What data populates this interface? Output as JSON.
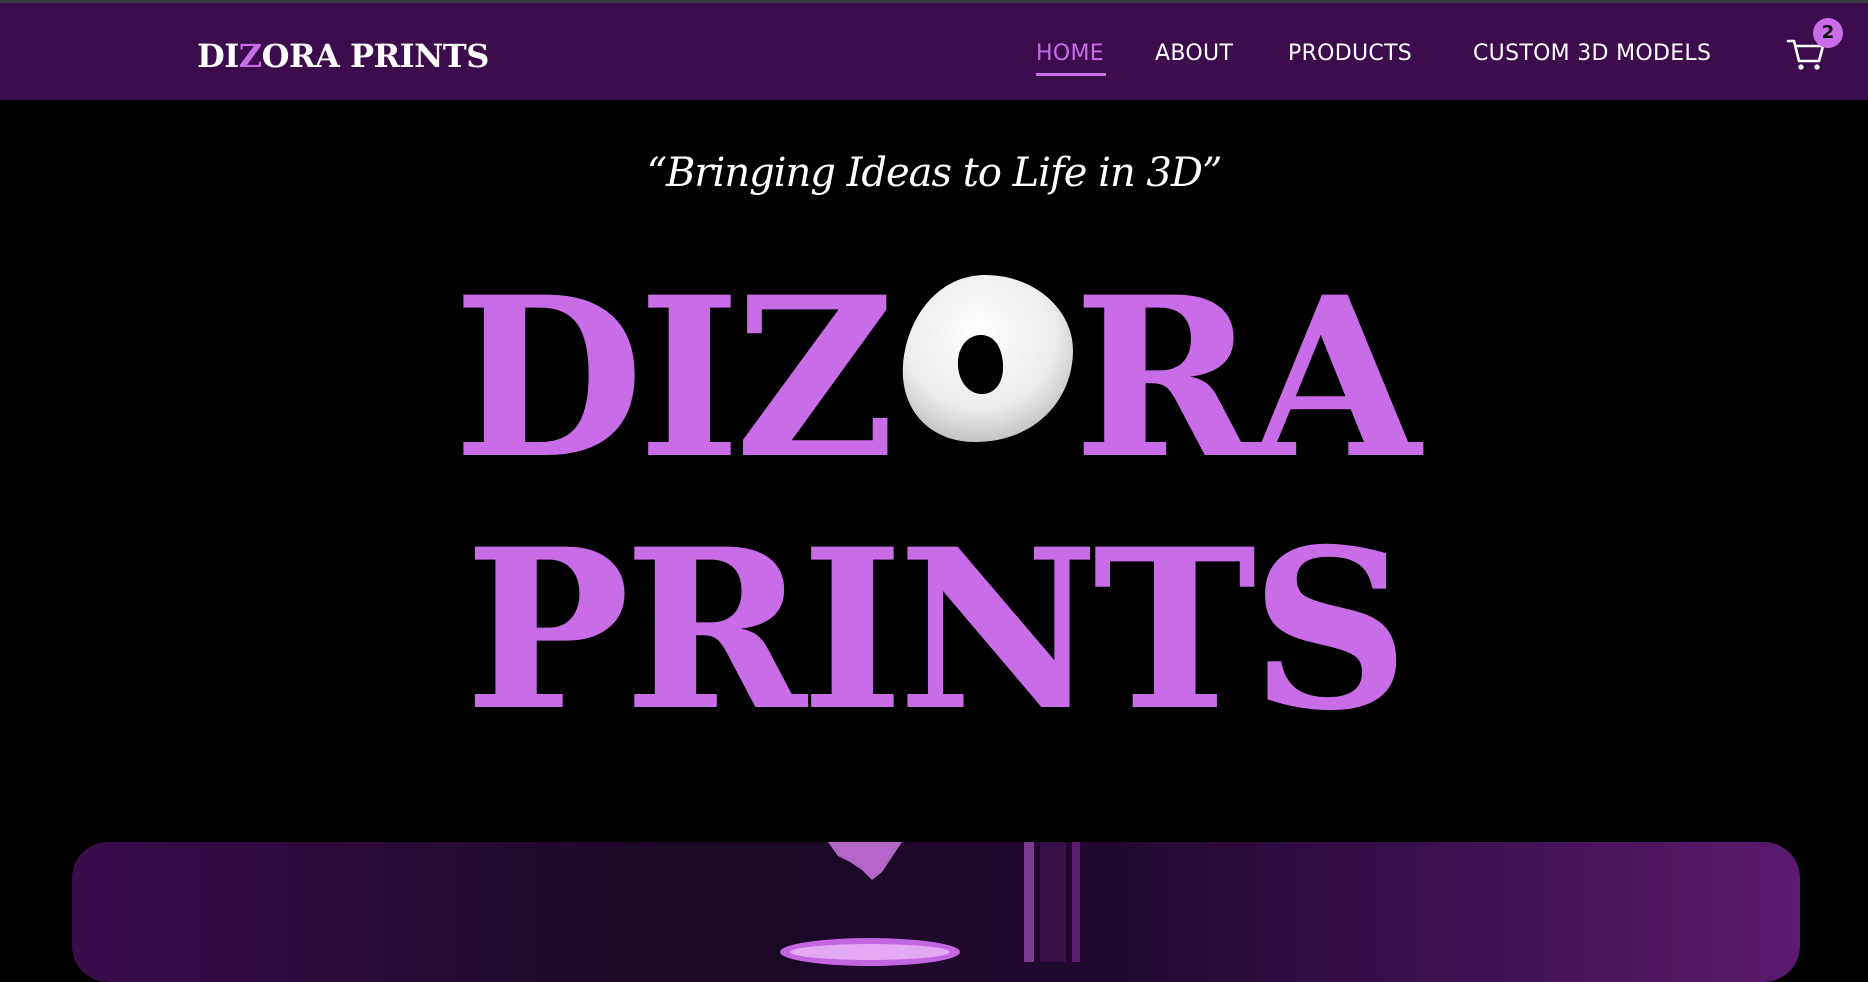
{
  "brand": {
    "logo_part1": "DI",
    "logo_accent": "Z",
    "logo_part2": "ORA PRINTS"
  },
  "nav": {
    "items": [
      {
        "label": "HOME",
        "active": true
      },
      {
        "label": "ABOUT",
        "active": false
      },
      {
        "label": "PRODUCTS",
        "active": false
      },
      {
        "label": "CUSTOM 3D MODELS",
        "active": false
      }
    ],
    "cart_icon": "shopping-cart-icon",
    "cart_count": "2"
  },
  "hero": {
    "tagline": "“Bringing Ideas to Life in 3D”",
    "line1_left": "DIZ",
    "line1_right": "RA",
    "line2": "PRINTS",
    "o_graphic": "white-3d-donut-o"
  },
  "colors": {
    "navbar_bg": "#3c0c4c",
    "accent": "#c86ce8",
    "page_bg": "#000000",
    "text": "#ffffff"
  }
}
